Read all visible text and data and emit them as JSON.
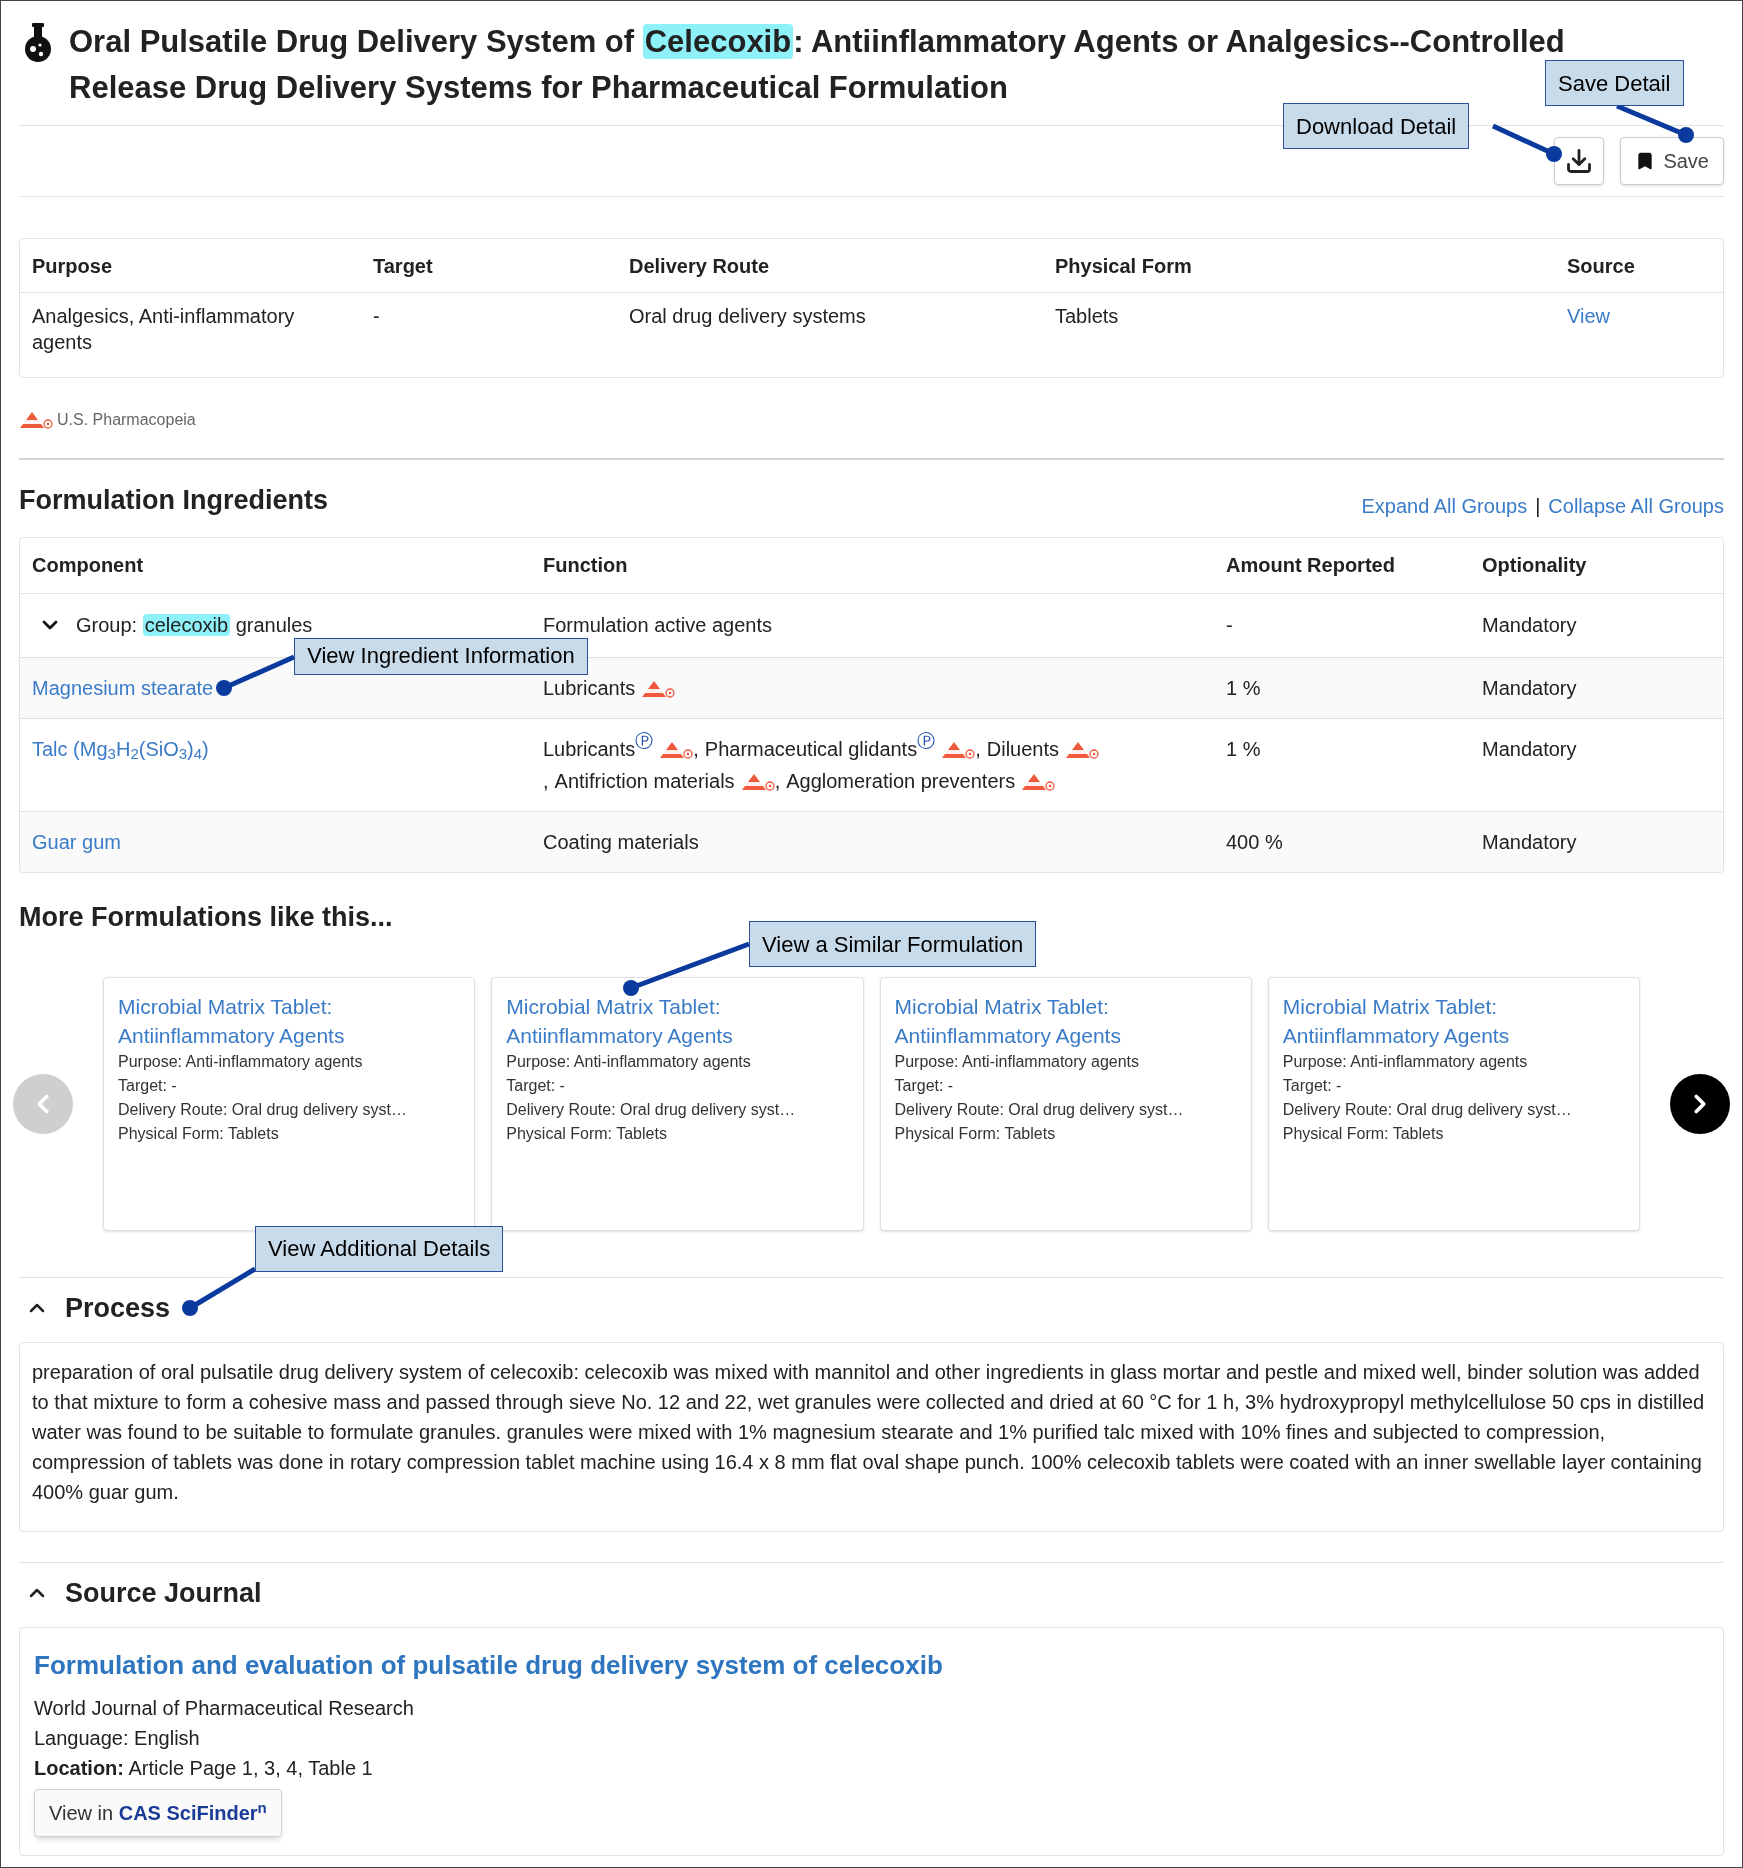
{
  "header": {
    "title_parts": [
      {
        "text": "Oral Pulsatile Drug Delivery System of ",
        "highlighted": false
      },
      {
        "text": "Celecoxib",
        "highlighted": true
      },
      {
        "text": ": Antiinflammatory Agents or Analgesics--Controlled Release Drug Delivery Systems for Pharmaceutical Formulation",
        "highlighted": false
      }
    ]
  },
  "toolbar": {
    "save_callout": "Save Detail",
    "download_callout": "Download Detail",
    "save_label": "Save"
  },
  "summary": {
    "columns": [
      "Purpose",
      "Target",
      "Delivery Route",
      "Physical Form",
      "Source"
    ],
    "row": {
      "purpose": "Analgesics, Anti-inflammatory agents",
      "target": "-",
      "delivery_route": "Oral drug delivery systems",
      "physical_form": "Tablets",
      "source": "View"
    }
  },
  "legend": "U.S. Pharmacopeia",
  "ingredients": {
    "title": "Formulation Ingredients",
    "expand_all": "Expand All Groups",
    "separator": "|",
    "collapse_all": "Collapse All Groups",
    "columns": [
      "Component",
      "Function",
      "Amount Reported",
      "Optionality"
    ],
    "group": {
      "expanded": true,
      "label_parts": [
        {
          "text": "Group: ",
          "highlighted": false
        },
        {
          "text": "celecoxib",
          "highlighted": true
        },
        {
          "text": " granules",
          "highlighted": false
        }
      ],
      "function": "Formulation active agents",
      "amount": "-",
      "optionality": "Mandatory"
    },
    "rows": [
      {
        "component": "Magnesium stearate",
        "callout": "View Ingredient Information",
        "functions": [
          {
            "label": "Lubricants",
            "usp": true
          }
        ],
        "amount": "1 %",
        "optionality": "Mandatory"
      },
      {
        "component": "Talc (Mg$_{3}$H$_{2}$(SiO$_{3}$)$_{4}$)",
        "separator": ",",
        "functions": [
          {
            "label": "Lubricants",
            "note": "Ⓟ",
            "usp": true
          },
          {
            "label": "Pharmaceutical glidants",
            "note": "Ⓟ",
            "usp": true
          },
          {
            "label": "Diluents",
            "usp": true
          },
          {
            "label": "Antifriction materials",
            "usp": true
          },
          {
            "label": "Agglomeration preventers",
            "usp": true
          }
        ],
        "amount": "1 %",
        "optionality": "Mandatory"
      },
      {
        "component": "Guar gum",
        "functions": [
          {
            "label": "Coating materials",
            "usp": false
          }
        ],
        "amount": "400 %",
        "optionality": "Mandatory"
      }
    ]
  },
  "more": {
    "title": "More Formulations like this...",
    "callout": "View a Similar Formulation",
    "prev_disabled": true,
    "next_disabled": false,
    "cards": [
      {
        "title": "Microbial Matrix Tablet: Antiinflammatory Agents",
        "lines": [
          "Purpose: Anti-inflammatory agents",
          "Target: -",
          "Delivery Route: Oral drug delivery syst…",
          "Physical Form: Tablets"
        ]
      },
      {
        "title": "Microbial Matrix Tablet: Antiinflammatory Agents",
        "lines": [
          "Purpose: Anti-inflammatory agents",
          "Target: -",
          "Delivery Route: Oral drug delivery syst…",
          "Physical Form: Tablets"
        ]
      },
      {
        "title": "Microbial Matrix Tablet: Antiinflammatory Agents",
        "lines": [
          "Purpose: Anti-inflammatory agents",
          "Target: -",
          "Delivery Route: Oral drug delivery syst…",
          "Physical Form: Tablets"
        ]
      },
      {
        "title": "Microbial Matrix Tablet: Antiinflammatory Agents",
        "lines": [
          "Purpose: Anti-inflammatory agents",
          "Target: -",
          "Delivery Route: Oral drug delivery syst…",
          "Physical Form: Tablets"
        ]
      }
    ]
  },
  "process": {
    "title": "Process",
    "expanded": true,
    "callout": "View Additional Details",
    "text": "preparation of oral pulsatile drug delivery system of celecoxib: celecoxib was mixed with mannitol and other ingredients in glass mortar and pestle and mixed well, binder solution was added to that mixture to form a cohesive mass and passed through sieve No. 12 and 22, wet granules were collected and dried at 60 °C for 1 h, 3% hydroxypropyl methylcellulose 50 cps in distilled water was found to be suitable to formulate granules. granules were mixed with 1% magnesium stearate and 1% purified talc mixed with 10% fines and subjected to compression, compression of tablets was done in rotary compression tablet machine using 16.4 x 8 mm flat oval shape punch. 100% celecoxib tablets were coated with an inner swellable layer containing 400% guar gum."
  },
  "source_journal": {
    "title": "Source Journal",
    "expanded": true,
    "article_title": "Formulation and evaluation of pulsatile drug delivery system of celecoxib",
    "journal": "World Journal of Pharmaceutical Research",
    "language": "Language: English",
    "location": "**Location:** Article Page 1, 3, 4, Table 1",
    "button_prefix": "View in",
    "button_brand": "CAS SciFinder$^{n}$"
  }
}
